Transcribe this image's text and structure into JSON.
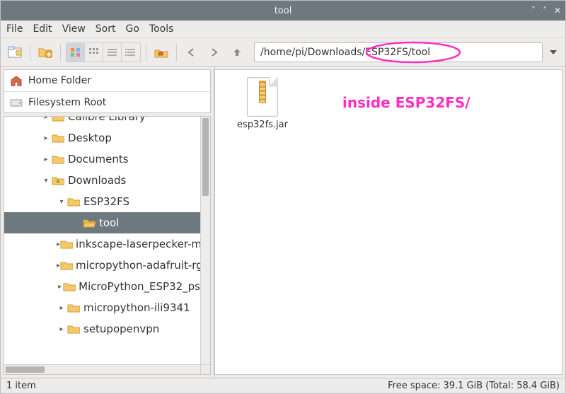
{
  "window": {
    "title": "tool"
  },
  "window_controls": {
    "min": "˅",
    "max": "˄",
    "close": "✕"
  },
  "menubar": [
    "File",
    "Edit",
    "View",
    "Sort",
    "Go",
    "Tools"
  ],
  "toolbar": {
    "path_value": "/home/pi/Downloads/ESP32FS/tool",
    "icons": {
      "new_tab": "new-tab-icon",
      "new_folder": "new-folder-icon",
      "view_icons": "view-icons-icon",
      "view_compact": "view-compact-icon",
      "view_list": "view-list-icon",
      "view_detail": "view-detail-icon",
      "home": "home-icon",
      "back": "back-icon",
      "forward": "forward-icon",
      "up": "up-icon",
      "path_dropdown": "dropdown-icon"
    }
  },
  "places": [
    {
      "type": "home",
      "label": "Home Folder"
    },
    {
      "type": "disk",
      "label": "Filesystem Root"
    }
  ],
  "tree": [
    {
      "depth": 2,
      "exp": "closed",
      "icon": "folder",
      "label": "Calibre Library"
    },
    {
      "depth": 2,
      "exp": "closed",
      "icon": "folder",
      "label": "Desktop"
    },
    {
      "depth": 2,
      "exp": "closed",
      "icon": "folder",
      "label": "Documents"
    },
    {
      "depth": 2,
      "exp": "open",
      "icon": "downloads",
      "label": "Downloads"
    },
    {
      "depth": 3,
      "exp": "open",
      "icon": "folder",
      "label": "ESP32FS"
    },
    {
      "depth": 4,
      "exp": "none",
      "icon": "folder-open",
      "label": "tool",
      "selected": true
    },
    {
      "depth": 3,
      "exp": "closed",
      "icon": "folder",
      "label": "inkscape-laserpecker-m"
    },
    {
      "depth": 3,
      "exp": "closed",
      "icon": "folder",
      "label": "micropython-adafruit-rg"
    },
    {
      "depth": 3,
      "exp": "closed",
      "icon": "folder",
      "label": "MicroPython_ESP32_ps"
    },
    {
      "depth": 3,
      "exp": "closed",
      "icon": "folder",
      "label": "micropython-ili9341"
    },
    {
      "depth": 3,
      "exp": "closed",
      "icon": "folder",
      "label": "setupopenvpn"
    }
  ],
  "files": [
    {
      "name": "esp32fs.jar",
      "type": "archive"
    }
  ],
  "annotation": {
    "text": "inside ESP32FS/"
  },
  "statusbar": {
    "left": "1 item",
    "right": "Free space: 39.1 GiB (Total: 58.4 GiB)"
  }
}
